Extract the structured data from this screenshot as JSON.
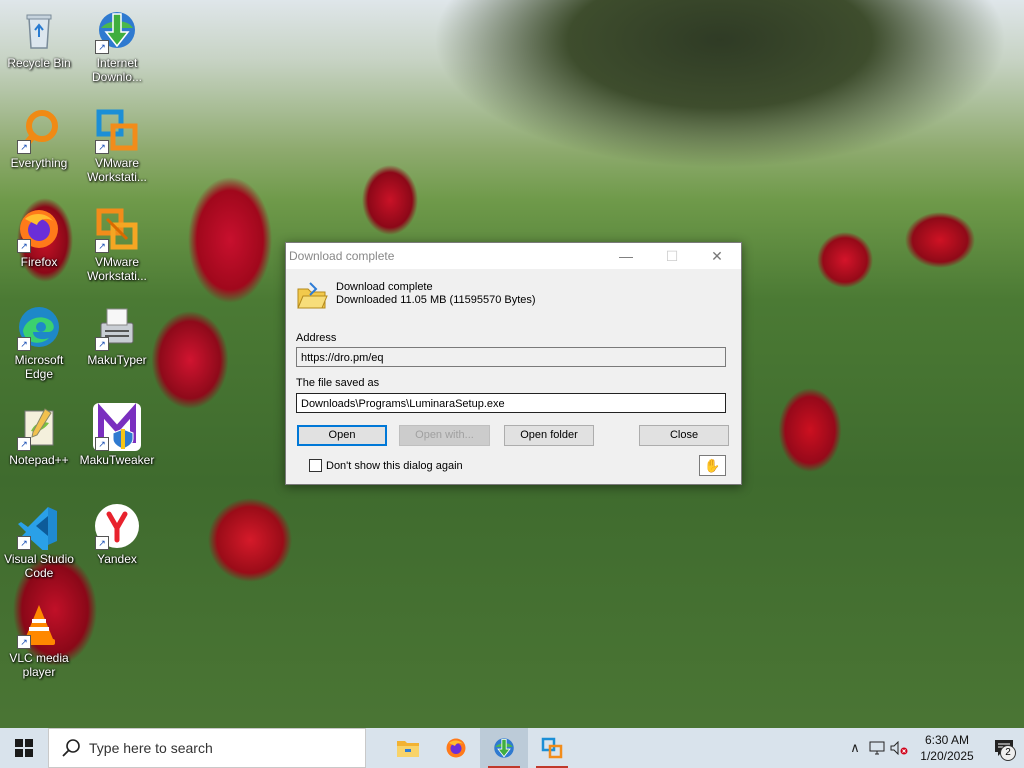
{
  "desktop_icons": [
    {
      "label": "Recycle Bin",
      "icon": "recycle-bin-icon"
    },
    {
      "label": "Internet Downlo...",
      "icon": "internet-download-manager-icon"
    },
    {
      "label": "Everything",
      "icon": "everything-search-icon"
    },
    {
      "label": "VMware Workstati...",
      "icon": "vmware-workstation-icon"
    },
    {
      "label": "Firefox",
      "icon": "firefox-icon"
    },
    {
      "label": "VMware Workstati...",
      "icon": "vmware-workstation-player-icon"
    },
    {
      "label": "Microsoft Edge",
      "icon": "edge-icon"
    },
    {
      "label": "MakuTyper",
      "icon": "makutyper-icon"
    },
    {
      "label": "Notepad++",
      "icon": "notepadpp-icon"
    },
    {
      "label": "MakuTweaker",
      "icon": "makutweaker-icon"
    },
    {
      "label": "Visual Studio Code",
      "icon": "vscode-icon"
    },
    {
      "label": "Yandex",
      "icon": "yandex-icon"
    },
    {
      "label": "VLC media player",
      "icon": "vlc-icon"
    }
  ],
  "dialog": {
    "title": "Download complete",
    "heading": "Download complete",
    "downloaded_text": "Downloaded 11.05  MB (11595570 Bytes)",
    "address_label": "Address",
    "address_value": "https://dro.pm/eq",
    "saved_as_label": "The file saved as",
    "saved_as_value": "Downloads\\Programs\\LuminaraSetup.exe",
    "buttons": {
      "open": "Open",
      "open_with": "Open with...",
      "open_folder": "Open folder",
      "close": "Close"
    },
    "checkbox_label": "Don't show this dialog again",
    "minimize_glyph": "—",
    "maximize_glyph": "☐",
    "close_glyph": "✕"
  },
  "taskbar": {
    "search_placeholder": "Type here to search",
    "apps": [
      {
        "name": "file-explorer",
        "icon": "folder-icon"
      },
      {
        "name": "firefox",
        "icon": "firefox-icon"
      },
      {
        "name": "internet-download-manager",
        "icon": "internet-download-manager-icon",
        "active": true
      },
      {
        "name": "vmware-workstation",
        "icon": "vmware-workstation-icon",
        "running": true
      }
    ],
    "time": "6:30 AM",
    "date": "1/20/2025",
    "notification_count": "2"
  },
  "colors": {
    "accent": "#0078d7",
    "taskbar_bg": "#d9e3ec",
    "dialog_bg": "#f0f0f0"
  }
}
